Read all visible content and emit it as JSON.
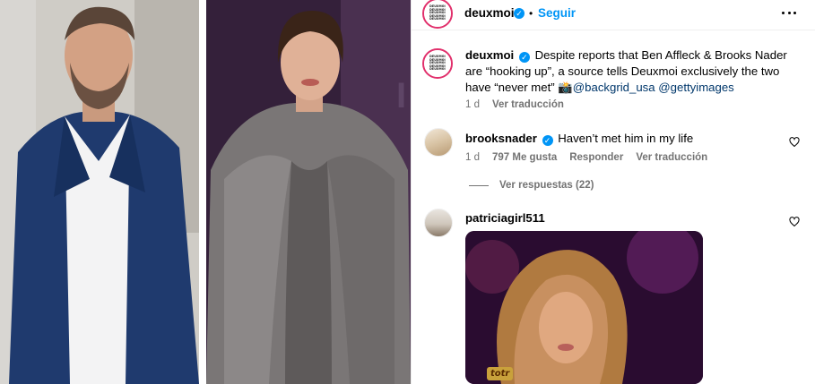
{
  "post": {
    "author": "deuxmoi",
    "follow_label": "Seguir",
    "dot": "•",
    "brand_avatar_lines": [
      "DEUXMOI",
      "DEUXMOI",
      "DEUXMOI",
      "DEUXMOI",
      "DEUXMOI"
    ],
    "caption_text": "Despite reports that Ben Affleck & Brooks Nader are “hooking up”, a source tells Deuxmoi exclusively the two have “never met” ",
    "caption_emoji": "📸",
    "mention_1": "@backgrid_usa",
    "mention_2": "@gettyimages",
    "time": "1 d",
    "translate": "Ver traducción"
  },
  "comments": [
    {
      "username": "brooksnader",
      "text": "Haven’t met him in my life",
      "time": "1 d",
      "likes": "797 Me gusta",
      "reply": "Responder",
      "translate": "Ver traducción",
      "view_replies": "Ver respuestas (22)"
    },
    {
      "username": "patriciagirl511",
      "gif_label": "totr"
    }
  ],
  "colors": {
    "accent": "#0095f6",
    "link": "#00376b",
    "muted": "#737373",
    "ring": "#e1306c"
  }
}
